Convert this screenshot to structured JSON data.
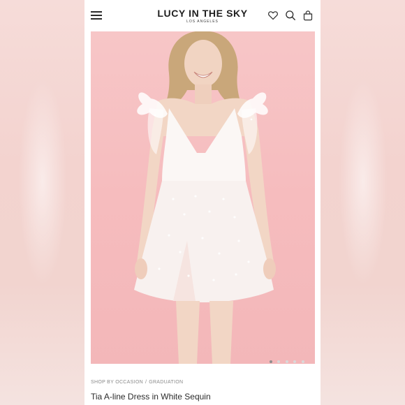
{
  "header": {
    "brand_name": "LUCY IN THE SKY",
    "brand_sub": "LOS ANGELES",
    "menu_icon": "hamburger-menu-icon",
    "wishlist_icon": "heart-icon",
    "search_icon": "search-icon",
    "cart_icon": "shopping-bag-icon"
  },
  "carousel": {
    "slide_count": 5,
    "active_slide": 1
  },
  "breadcrumb": {
    "items": [
      "SHOP BY OCCASION",
      "GRADUATION"
    ],
    "separator": "/"
  },
  "product": {
    "title": "Tia A-line Dress in White Sequin"
  },
  "colors": {
    "background_pink": "#f7c6c7",
    "text_dark": "#2b2b2b",
    "text_muted": "#8a8a8a"
  }
}
